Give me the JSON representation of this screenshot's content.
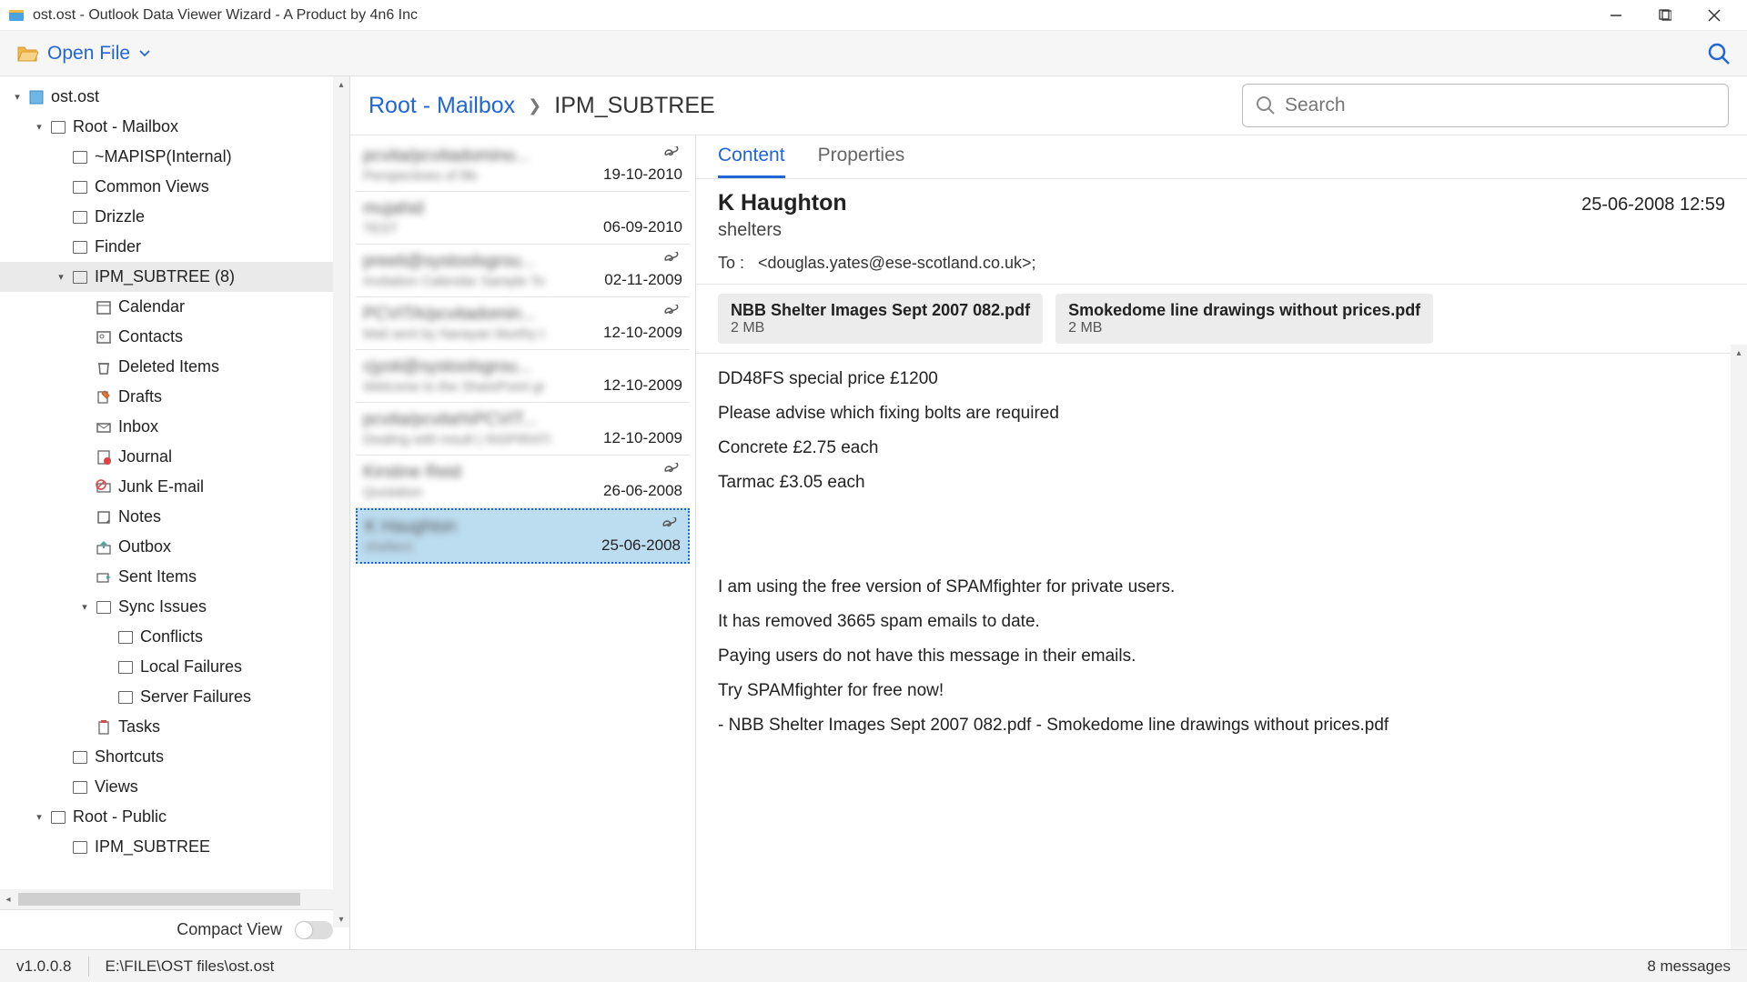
{
  "titlebar": {
    "text": "ost.ost - Outlook Data Viewer Wizard - A Product by 4n6 Inc"
  },
  "toolbar": {
    "open_file": "Open File"
  },
  "tree": {
    "root": "ost.ost",
    "n0": "Root - Mailbox",
    "n1": "~MAPISP(Internal)",
    "n2": "Common Views",
    "n3": "Drizzle",
    "n4": "Finder",
    "n5": "IPM_SUBTREE (8)",
    "n6": "Calendar",
    "n7": "Contacts",
    "n8": "Deleted Items",
    "n9": "Drafts",
    "n10": "Inbox",
    "n11": "Journal",
    "n12": "Junk E-mail",
    "n13": "Notes",
    "n14": "Outbox",
    "n15": "Sent Items",
    "n16": "Sync Issues",
    "n17": "Conflicts",
    "n18": "Local Failures",
    "n19": "Server Failures",
    "n20": "Tasks",
    "n21": "Shortcuts",
    "n22": "Views",
    "n23": "Root - Public",
    "n24": "IPM_SUBTREE"
  },
  "compact_view_label": "Compact View",
  "breadcrumb": {
    "a": "Root - Mailbox",
    "b": "IPM_SUBTREE"
  },
  "search_placeholder": "Search",
  "messages": [
    {
      "from": "pcvita/pcvitadomino...",
      "sub": "Perspectives of life",
      "date": "19-10-2010",
      "clip": true
    },
    {
      "from": "mujahid",
      "sub": "TEST",
      "date": "06-09-2010",
      "clip": false
    },
    {
      "from": "preeti@systoolsgrou...",
      "sub": "Invitation Calendar Sample To",
      "date": "02-11-2009",
      "clip": true
    },
    {
      "from": "PCVITA/pcvitadomin...",
      "sub": "Mail sent by Narayan Murthy t",
      "date": "12-10-2009",
      "clip": true
    },
    {
      "from": "cjyoti@systoolsgrou...",
      "sub": "Welcome to the SharePoint gr",
      "date": "12-10-2009",
      "clip": false
    },
    {
      "from": "pcvita/pcvita%PCVIT...",
      "sub": "Dealing with insult ( INSPIRATI",
      "date": "12-10-2009",
      "clip": false
    },
    {
      "from": "Kirstine Reid",
      "sub": "Quotation",
      "date": "26-06-2008",
      "clip": true
    },
    {
      "from": "K Haughton",
      "sub": "shelters",
      "date": "25-06-2008",
      "clip": true
    }
  ],
  "tabs": {
    "content": "Content",
    "properties": "Properties"
  },
  "detail": {
    "from": "K Haughton",
    "date": "25-06-2008 12:59",
    "subject": "shelters",
    "to_label": "To :",
    "to_value": "<douglas.yates@ese-scotland.co.uk>;",
    "attachments": [
      {
        "name": "NBB Shelter Images Sept 2007 082.pdf",
        "size": "2 MB"
      },
      {
        "name": "Smokedome line drawings without prices.pdf",
        "size": "2 MB"
      }
    ],
    "body_lines": [
      "DD48FS special price £1200",
      "Please advise which fixing bolts are required",
      "Concrete £2.75 each",
      "Tarmac £3.05 each",
      "",
      "",
      "I am using the free version of SPAMfighter for private users.",
      "It has removed 3665 spam emails to date.",
      "Paying users do not have this message in their emails.",
      "Try SPAMfighter for free now!",
      " - NBB Shelter Images Sept 2007 082.pdf - Smokedome line drawings without prices.pdf"
    ]
  },
  "status": {
    "version": "v1.0.0.8",
    "path": "E:\\FILE\\OST files\\ost.ost",
    "count": "8  messages"
  }
}
